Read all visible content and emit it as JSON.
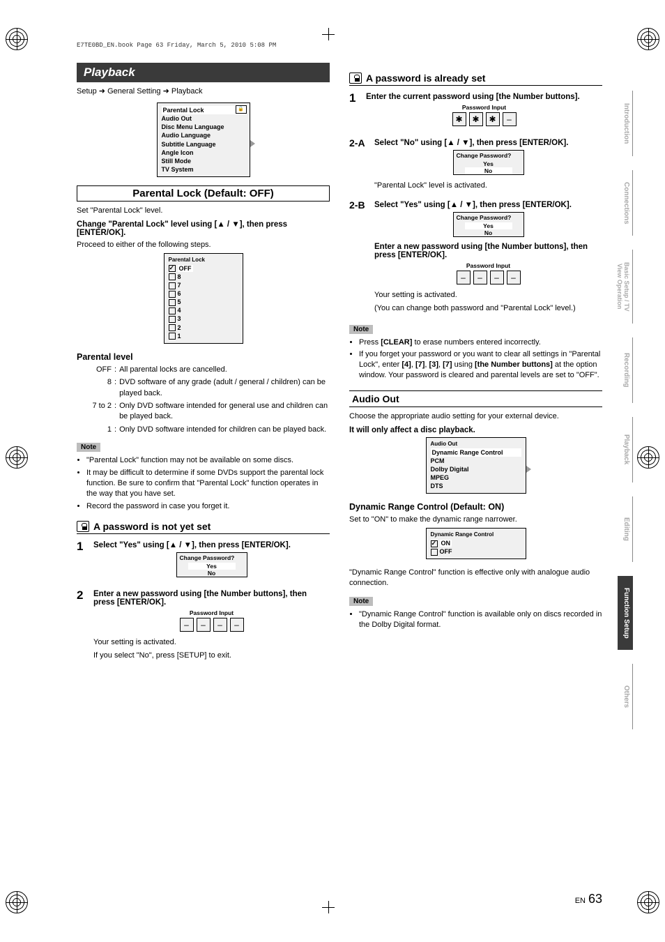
{
  "header_line": "E7TE0BD_EN.book  Page 63  Friday, March 5, 2010  5:08 PM",
  "section_title": "Playback",
  "breadcrumb": [
    "Setup",
    "General Setting",
    "Playback"
  ],
  "playback_menu": {
    "items": [
      "Parental Lock",
      "Audio Out",
      "Disc Menu Language",
      "Audio Language",
      "Subtitle Language",
      "Angle Icon",
      "Still Mode",
      "TV System"
    ]
  },
  "parental_lock": {
    "heading": "Parental Lock (Default: OFF)",
    "set_level": "Set \"Parental Lock\" level.",
    "change_instruction": "Change \"Parental Lock\" level using [▲ / ▼], then press [ENTER/OK].",
    "proceed": "Proceed to either of the following steps.",
    "levels_title": "Parental Lock",
    "levels": [
      "OFF",
      "8",
      "7",
      "6",
      "5",
      "4",
      "3",
      "2",
      "1"
    ],
    "level_heading": "Parental level",
    "level_descriptions": [
      {
        "label": "OFF",
        "sep": ":",
        "text": "All parental locks are cancelled."
      },
      {
        "label": "8",
        "sep": ":",
        "text": "DVD software of any grade (adult / general / children) can be played back."
      },
      {
        "label": "7 to 2",
        "sep": ":",
        "text": "Only DVD software intended for general use and children can be played back."
      },
      {
        "label": "1",
        "sep": ":",
        "text": "Only DVD software intended for children can be played back."
      }
    ],
    "notes": [
      "\"Parental Lock\" function may not be available on some discs.",
      "It may be difficult to determine if some DVDs support the parental lock function. Be sure to confirm that \"Parental Lock\" function operates in the way that you have set.",
      "Record the password in case you forget it."
    ]
  },
  "pwd_not_set": {
    "heading": "A password is not yet set",
    "step1": "Select \"Yes\" using [▲ / ▼], then press [ENTER/OK].",
    "change_pw_title": "Change Password?",
    "yes": "Yes",
    "no": "No",
    "step2": "Enter a new password using [the Number buttons], then press [ENTER/OK].",
    "pw_input_title": "Password Input",
    "pw_chars": [
      "–",
      "–",
      "–",
      "–"
    ],
    "activated": "Your setting is activated.",
    "if_no": "If you select \"No\", press [SETUP] to exit."
  },
  "pwd_set": {
    "heading": "A password is already set",
    "step1": "Enter the current password using [the Number buttons].",
    "pw_input_title": "Password Input",
    "pw_chars_filled": [
      "✱",
      "✱",
      "✱",
      "–"
    ],
    "step2a_label": "2-A",
    "step2a": "Select \"No\" using [▲ / ▼], then press [ENTER/OK].",
    "change_pw_title": "Change Password?",
    "yes": "Yes",
    "no": "No",
    "activated_a": "\"Parental Lock\" level is activated.",
    "step2b_label": "2-B",
    "step2b": "Select \"Yes\" using [▲ / ▼], then press [ENTER/OK].",
    "enter_new": "Enter a new password using [the Number buttons], then press [ENTER/OK].",
    "pw_chars_empty": [
      "–",
      "–",
      "–",
      "–"
    ],
    "activated_b": "Your setting is activated.",
    "change_both": "(You can change both password and \"Parental Lock\" level.)",
    "note_label": "Note",
    "notes_html": [
      "Press [CLEAR] to erase numbers entered incorrectly.",
      "If you forget your password or you want to clear all settings in \"Parental Lock\", enter [4], [7], [3], [7] using [the Number buttons] at the option window. Your password is cleared and parental levels are set to \"OFF\"."
    ]
  },
  "audio_out": {
    "heading": "Audio Out",
    "intro": "Choose the appropriate audio setting for your external device.",
    "bold_note": "It will only affect a disc playback.",
    "menu_title": "Audio Out",
    "menu_items": [
      "Dynamic Range Control",
      "PCM",
      "Dolby Digital",
      "MPEG",
      "DTS"
    ],
    "drc_heading": "Dynamic Range Control (Default: ON)",
    "drc_text": "Set to \"ON\" to make the dynamic range narrower.",
    "drc_menu_title": "Dynamic Range Control",
    "drc_on": "ON",
    "drc_off": "OFF",
    "drc_effective": "\"Dynamic Range Control\" function is effective only with analogue audio connection.",
    "note_label": "Note",
    "notes": [
      "\"Dynamic Range Control\" function is available only on discs recorded in the Dolby Digital format."
    ]
  },
  "tabs": [
    "Introduction",
    "Connections",
    "Basic Setup / TV View Operation",
    "Recording",
    "Playback",
    "Editing",
    "Function Setup",
    "Others"
  ],
  "page_lang": "EN",
  "page_num": "63",
  "note_label": "Note"
}
